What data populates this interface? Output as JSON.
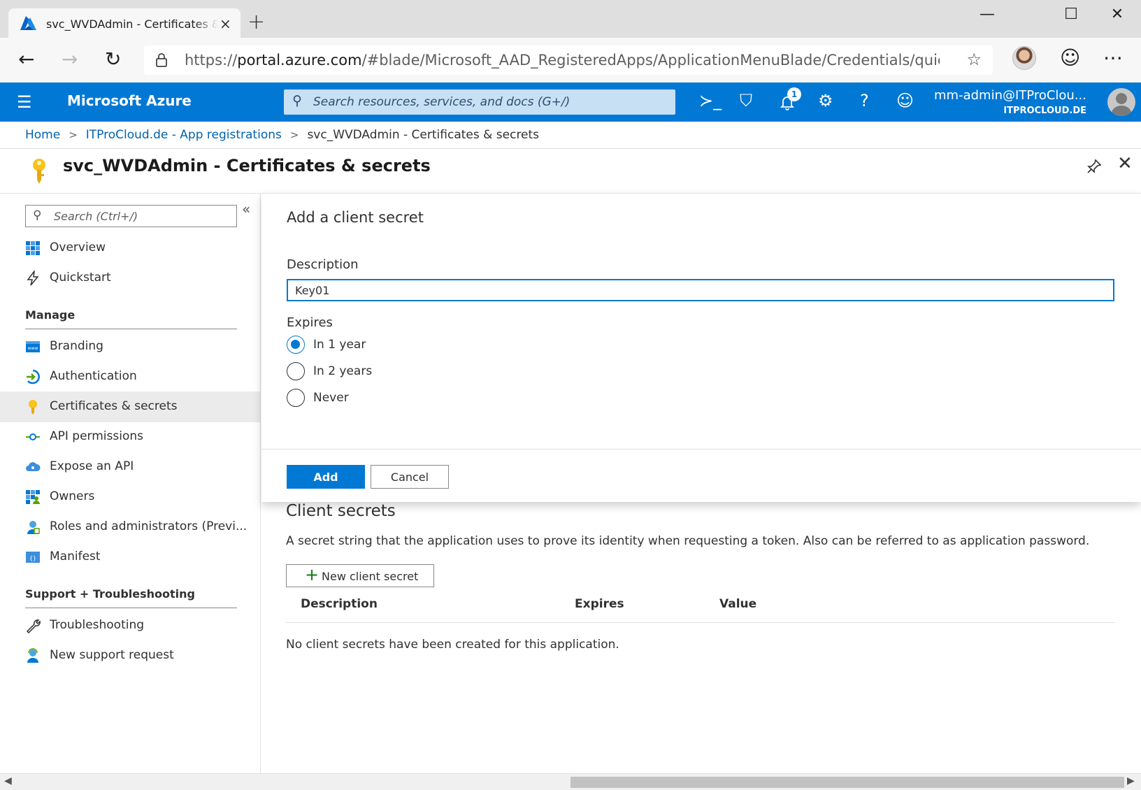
{
  "browser": {
    "tab_title": "svc_WVDAdmin - Certificates & secrets",
    "tab_close": "×",
    "new_tab": "+",
    "url_prefix": "https://",
    "url_host": "portal.azure.com",
    "url_path": "/#blade/Microsoft_AAD_RegisteredApps/ApplicationMenuBlade/Credentials/quickSta...",
    "controls": {
      "minimize": "—",
      "maximize": "☐",
      "close": "✕"
    },
    "icons": {
      "back": "←",
      "forward": "→",
      "refresh": "↻",
      "lock": "🔒",
      "favorite": "☆",
      "feedback": "☺",
      "more": "⋯"
    }
  },
  "azure": {
    "brand": "Microsoft Azure",
    "menu_icon": "☰",
    "search_placeholder": "Search resources, services, and docs (G+/)",
    "icons": {
      "cloud_shell": "≻_",
      "directory": "⛉",
      "notifications": "🔔",
      "settings": "⚙",
      "help": "?",
      "feedback": "☺"
    },
    "notification_count": "1",
    "account_name": "mm-admin@ITProClou...",
    "account_tenant": "ITPROCLOUD.DE"
  },
  "breadcrumb": {
    "home": "Home",
    "app_registrations": "ITProCloud.de - App registrations",
    "current": "svc_WVDAdmin - Certificates & secrets",
    "separator": ">"
  },
  "page": {
    "title": "svc_WVDAdmin - Certificates & secrets",
    "pin_icon": "📌",
    "close_icon": "✕"
  },
  "sidebar": {
    "search_placeholder": "Search (Ctrl+/)",
    "collapse_icon": "«",
    "top_items": [
      {
        "label": "Overview",
        "icon": "grid-icon"
      },
      {
        "label": "Quickstart",
        "icon": "lightning-icon"
      }
    ],
    "manage_heading": "Manage",
    "manage_items": [
      {
        "label": "Branding",
        "icon": "branding-icon"
      },
      {
        "label": "Authentication",
        "icon": "authentication-icon"
      },
      {
        "label": "Certificates & secrets",
        "icon": "key-icon",
        "selected": true
      },
      {
        "label": "API permissions",
        "icon": "api-permissions-icon"
      },
      {
        "label": "Expose an API",
        "icon": "cloud-icon"
      },
      {
        "label": "Owners",
        "icon": "owners-icon"
      },
      {
        "label": "Roles and administrators (Previ...",
        "icon": "roles-icon"
      },
      {
        "label": "Manifest",
        "icon": "manifest-icon"
      }
    ],
    "support_heading": "Support + Troubleshooting",
    "support_items": [
      {
        "label": "Troubleshooting",
        "icon": "wrench-icon"
      },
      {
        "label": "New support request",
        "icon": "support-person-icon"
      }
    ]
  },
  "add_secret_panel": {
    "title": "Add a client secret",
    "description_label": "Description",
    "description_value": "Key01",
    "expires_label": "Expires",
    "expires_options": [
      {
        "label": "In 1 year",
        "checked": true
      },
      {
        "label": "In 2 years",
        "checked": false
      },
      {
        "label": "Never",
        "checked": false
      }
    ],
    "add_button": "Add",
    "cancel_button": "Cancel"
  },
  "client_secrets": {
    "title": "Client secrets",
    "description": "A secret string that the application uses to prove its identity when requesting a token. Also can be referred to as application password.",
    "new_button": "New client secret",
    "plus_icon": "+",
    "columns": [
      "Description",
      "Expires",
      "Value"
    ],
    "empty_message": "No client secrets have been created for this application."
  },
  "scrollbar": {
    "left_arrow": "◀",
    "right_arrow": "▶"
  },
  "colors": {
    "azure_blue": "#0078d4",
    "selected_bg": "#ebebeb",
    "link": "#0063b1"
  }
}
